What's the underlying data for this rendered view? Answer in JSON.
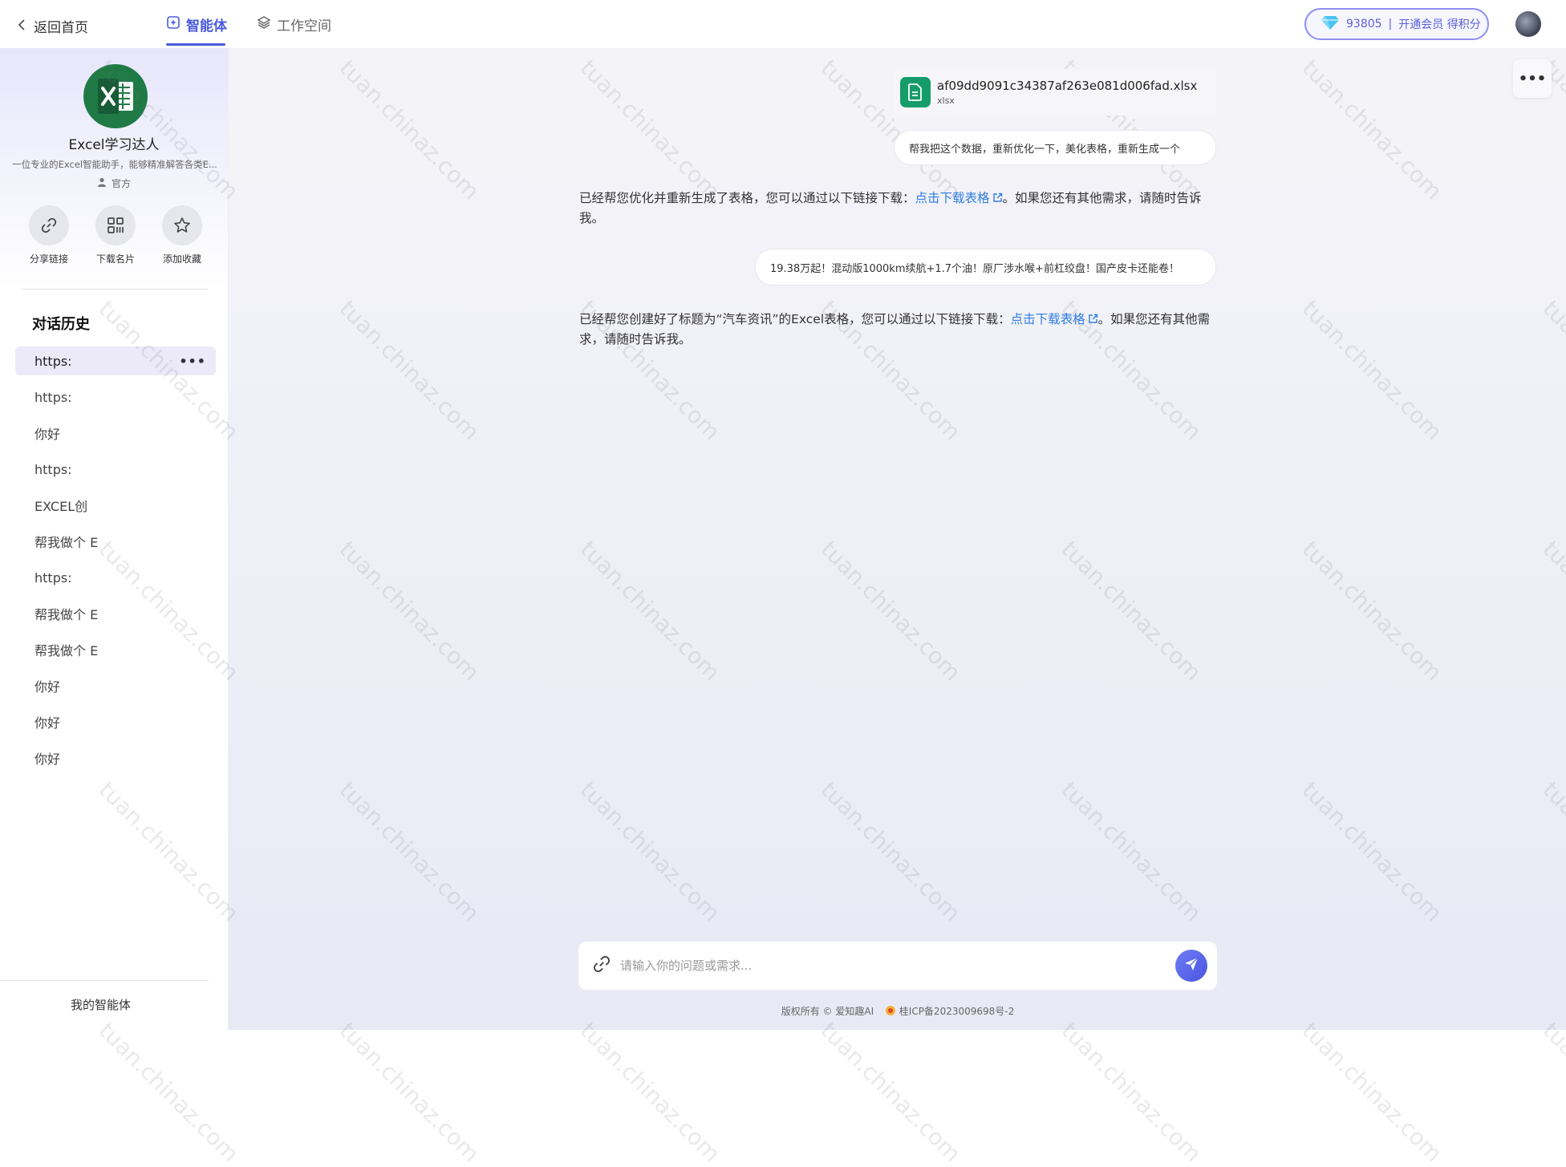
{
  "nav": {
    "back_label": "返回首页",
    "tabs": [
      {
        "label": "智能体",
        "active": true
      },
      {
        "label": "工作空间",
        "active": false
      }
    ],
    "vip": {
      "points": "93805",
      "cta": "开通会员 得积分"
    }
  },
  "agent": {
    "name": "Excel学习达人",
    "description": "一位专业的Excel智能助手，能够精准解答各类E...",
    "badge": "官方",
    "actions": [
      {
        "label": "分享链接",
        "icon": "link-icon"
      },
      {
        "label": "下载名片",
        "icon": "qrcode-icon"
      },
      {
        "label": "添加收藏",
        "icon": "star-icon"
      }
    ]
  },
  "history": {
    "title": "对话历史",
    "items": [
      "https:",
      "https:",
      "你好",
      "https:",
      "EXCEL创",
      "帮我做个 E",
      "https:",
      "帮我做个 E",
      "帮我做个 E",
      "你好",
      "你好",
      "你好"
    ]
  },
  "my_agents_label": "我的智能体",
  "chat": {
    "file": {
      "name": "af09dd9091c34387af263e081d006fad.xlsx",
      "ext": "xlsx"
    },
    "user_msg_1": "帮我把这个数据，重新优化一下，美化表格，重新生成一个",
    "bot_msg_1": {
      "before": "已经帮您优化并重新生成了表格，您可以通过以下链接下载：",
      "link": "点击下载表格",
      "after": "。如果您还有其他需求，请随时告诉我。"
    },
    "user_msg_2": "19.38万起！混动版1000km续航+1.7个油！原厂涉水喉+前杠绞盘！国产皮卡还能卷！",
    "bot_msg_2": {
      "before": "已经帮您创建好了标题为“汽车资讯”的Excel表格，您可以通过以下链接下载：",
      "link": "点击下载表格",
      "after": "。如果您还有其他需求，请随时告诉我。"
    }
  },
  "input": {
    "placeholder": "请输入你的问题或需求..."
  },
  "footer": {
    "copyright": "版权所有 © 爱知趣AI",
    "icp": "桂ICP备2023009698号-2"
  },
  "watermark_text": "tuan.chinaz.com",
  "colors": {
    "accent": "#4a5bdc",
    "link": "#2f7de1",
    "excel_green": "#1f7a45",
    "file_green": "#169c6a"
  }
}
